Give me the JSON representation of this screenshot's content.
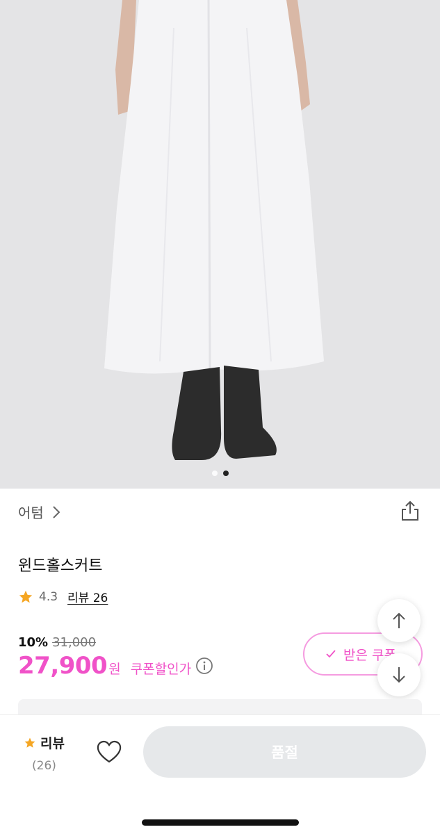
{
  "product": {
    "brand": "어텀",
    "title": "윈드홀스커트",
    "rating": "4.3",
    "review_link": "리뷰 26",
    "discount": "10%",
    "original_price": "31,000",
    "price": "27,900",
    "currency": "원",
    "coupon_label": "쿠폰할인가",
    "coupon_button": "받은 쿠폰"
  },
  "gallery": {
    "total_images": 2,
    "current_image": 2
  },
  "bottom_bar": {
    "review_label": "리뷰",
    "review_count": "(26)",
    "buy_button": "품절"
  },
  "colors": {
    "accent": "#f052c8",
    "star": "#f5a623",
    "soldout_bg": "#e6e8ea"
  },
  "icons": [
    "chevron-right-icon",
    "share-icon",
    "star-icon",
    "info-icon",
    "check-icon",
    "arrow-up-icon",
    "arrow-down-icon",
    "heart-icon"
  ]
}
